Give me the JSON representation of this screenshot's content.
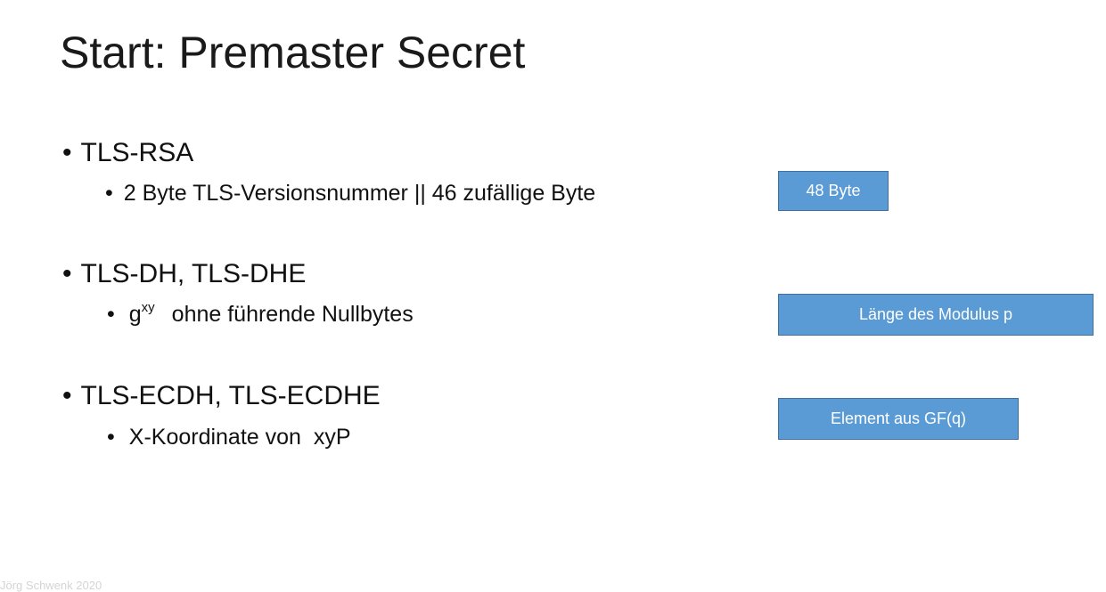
{
  "slide": {
    "title": "Start: Premaster Secret",
    "bullet_char": "•",
    "sections": [
      {
        "heading": "TLS-RSA",
        "sub": "2 Byte TLS-Versionsnummer || 46 zufällige Byte",
        "box": "48 Byte"
      },
      {
        "heading": "TLS-DH, TLS-DHE",
        "sub_base": "g",
        "sub_sup": "xy",
        "sub_rest": "ohne führende Nullbytes",
        "box": "Länge des Modulus p"
      },
      {
        "heading": "TLS-ECDH, TLS-ECDHE",
        "sub": "X-Koordinate von  xyP",
        "box": "Element aus GF(q)"
      }
    ],
    "footer": "Jörg Schwenk 2020"
  }
}
